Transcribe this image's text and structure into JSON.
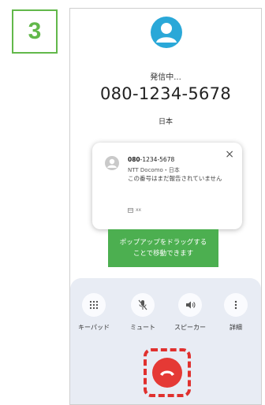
{
  "step": {
    "number": "3"
  },
  "caller": {
    "status": "発信中...",
    "number": "080-1234-5678",
    "region": "日本"
  },
  "popup": {
    "number_bold": "080",
    "number_rest": "-1234-5678",
    "carrier": "NTT Docomo・日本",
    "message": "この番号はまだ報告されていません",
    "mini_label": "xx",
    "close_glyph": "×"
  },
  "tooltip": {
    "line1": "ポップアップをドラッグする",
    "line2": "ことで移動できます"
  },
  "controls": [
    {
      "label": "キーパッド",
      "icon": "keypad-icon"
    },
    {
      "label": "ミュート",
      "icon": "mic-off-icon"
    },
    {
      "label": "スピーカー",
      "icon": "speaker-icon"
    },
    {
      "label": "詳細",
      "icon": "more-vert-icon"
    }
  ],
  "colors": {
    "accent_green": "#62b84a",
    "tooltip_green": "#4caf50",
    "avatar_blue": "#2aa8d8",
    "hangup_red": "#e53935",
    "highlight_red": "#e0302e",
    "panel_bg": "#e8ecf4"
  }
}
